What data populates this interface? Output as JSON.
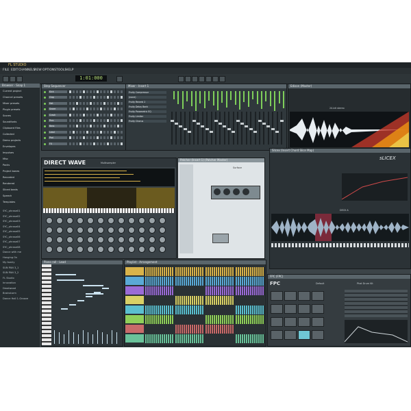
{
  "app": {
    "title": "FL STUDIO",
    "lcd": "1:01:000"
  },
  "menu": [
    "FILE",
    "EDIT",
    "CHANNELS",
    "VIEW",
    "OPTIONS",
    "TOOLS",
    "HELP"
  ],
  "browser": {
    "title": "Browser - Snap 1",
    "items": [
      "Current project",
      "Channel presets",
      "Mixer presets",
      "Plugin presets",
      "Scores",
      "Soundfonts",
      "Clipboard files",
      "Collected",
      "Demo projects",
      "Envelopes",
      "Impulses",
      "Misc",
      "Packs",
      "Project bones",
      "Recorded",
      "Rendered",
      "Sliced beats",
      "Speech",
      "Templates"
    ],
    "files": [
      "SYC_phrase01",
      "SYC_phrase02",
      "SYC_phrase03",
      "SYC_phrase04",
      "SYC_phrase05",
      "SYC_phrase06",
      "SYC_phrase07",
      "SYC_phrase08",
      "Dance with me",
      "Hanging On",
      "My family",
      "SUN PAN 3_1",
      "SUN PAN 3_2",
      "FL Studio",
      "Innovation",
      "Deadwood",
      "Brainstorm",
      "Dance Hall 1-Groove"
    ]
  },
  "step_sequencer": {
    "title": "Step Sequencer",
    "channels": [
      "Kick",
      "Clap",
      "Hat",
      "Snare",
      "Crash",
      "Perc",
      "Bass",
      "Lead",
      "Pad",
      "FX"
    ]
  },
  "mixer": {
    "title": "Mixer - Insert 1",
    "slots": [
      "Fruity Compressor",
      "(none)",
      "Fruity Reverb 2",
      "Fruity Delay Bank",
      "Fruity Parametric EQ",
      "Fruity Limiter",
      "Fruity Chorus"
    ]
  },
  "edison": {
    "title": "Edison (Master)",
    "info": "24-bit stereo"
  },
  "direct_wave": {
    "title": "DIRECT WAVE",
    "sub": "Multisampler"
  },
  "patcher": {
    "title": "Patcher (Insert 1) (Patcher Master)",
    "tab": "Surface"
  },
  "slicex": {
    "title": "Slicex (Insert Chord Slice Map)",
    "logo": "sLICEX",
    "deck": "DECK A"
  },
  "piano_roll": {
    "title": "Piano roll - Lead"
  },
  "playlist": {
    "title": "Playlist - Arrangement"
  },
  "fpc": {
    "title": "FPC (FPC)",
    "logo": "FPC",
    "preset": "Default",
    "kit": "Phat Drum Kit"
  }
}
